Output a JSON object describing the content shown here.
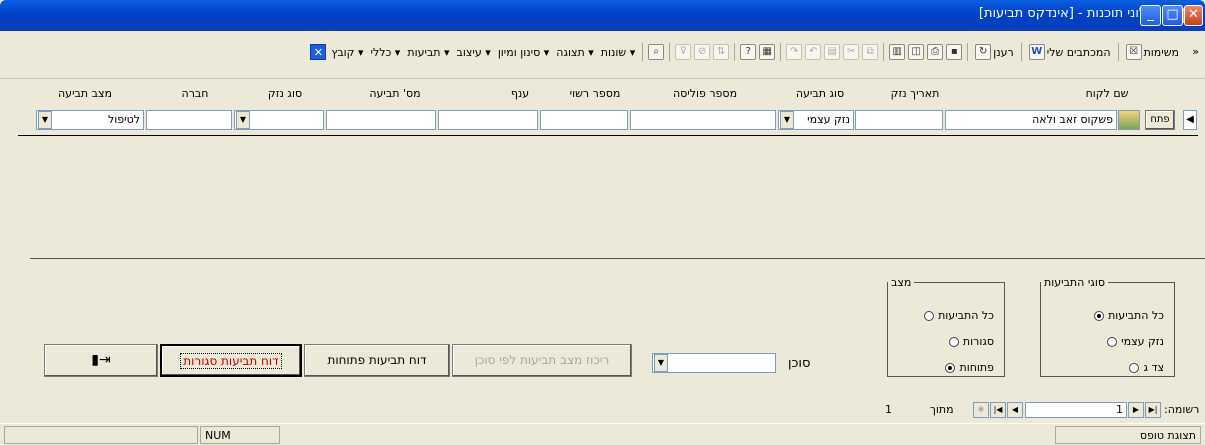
{
  "window": {
    "title": "אלוני תוכנות - [אינדקס תביעות]"
  },
  "menu": [
    {
      "label": "קובץ"
    },
    {
      "label": "כללי"
    },
    {
      "label": "תביעות"
    },
    {
      "label": "עיצוב"
    },
    {
      "label": "סינון ומיון"
    },
    {
      "label": "תצוגה"
    },
    {
      "label": "שונות"
    }
  ],
  "toolbar": {
    "refresh_label": "רענן",
    "letters_label": "המכתבים שלי",
    "tasks_label": "משימות"
  },
  "columns": [
    "שם לקוח",
    "תאריך נזק",
    "סוג תביעה",
    "מספר פוליסה",
    "מספר רשוי",
    "ענף",
    "מס' תביעה",
    "סוג נזק",
    "חברה",
    "מצב תביעה"
  ],
  "row": {
    "open_label": "פתח",
    "customer": "פשקוס זאב ולאה",
    "damage_date": "",
    "claim_type": "נזק עצמי",
    "policy_no": "",
    "license_no": "",
    "branch": "",
    "claim_no": "",
    "damage_type": "",
    "company": "",
    "status": "לטיפול"
  },
  "claim_types": {
    "legend": "סוגי התביעות",
    "options": [
      "כל התביעות",
      "נזק עצמי",
      "צד ג"
    ],
    "selected": 0
  },
  "status_group": {
    "legend": "מצב",
    "options": [
      "כל התביעות",
      "סגורות",
      "פתוחות"
    ],
    "selected": 2
  },
  "agent": {
    "label": "סוכן",
    "value": ""
  },
  "buttons": {
    "summary": "ריכוז מצב תביעות לפי סוכן",
    "open_report": "דוח תביעות פתוחות",
    "closed_report": "דוח תביעות סגורות"
  },
  "record_nav": {
    "label": "רשומה:",
    "current": "1",
    "of_label": "מתוך",
    "total": "1"
  },
  "status_bar": {
    "view": "תצוגת טופס",
    "num": "NUM"
  }
}
